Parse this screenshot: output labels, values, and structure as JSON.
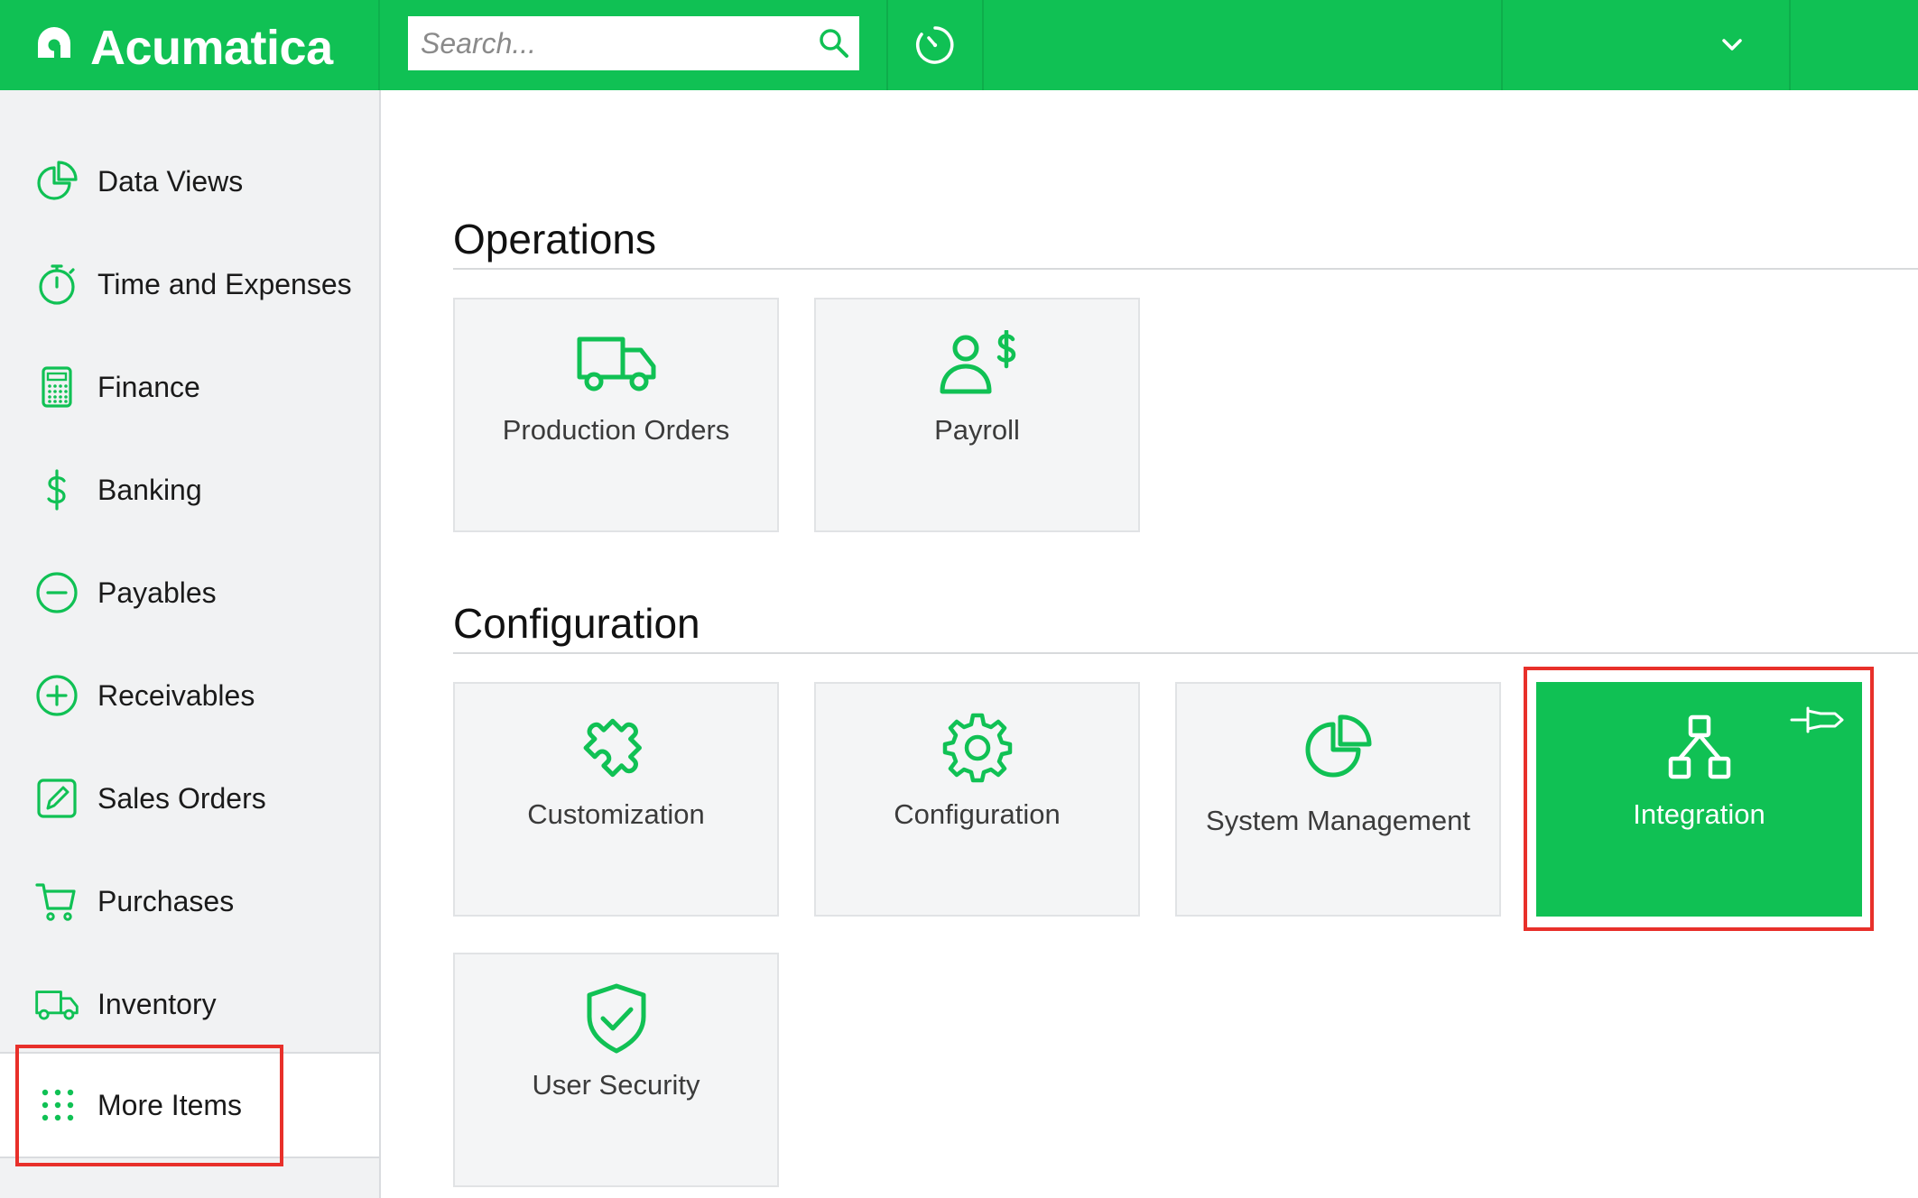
{
  "colors": {
    "brand_green": "#10c154",
    "highlight_red": "#e8302a"
  },
  "brand": {
    "name": "Acumatica",
    "icon": "acumatica-logo-icon"
  },
  "search": {
    "placeholder": "Search...",
    "value": "",
    "icon": "search-icon"
  },
  "toolbar": {
    "history_icon": "history-clock-icon",
    "dropdown_icon": "chevron-down-icon"
  },
  "sidebar": {
    "items": [
      {
        "label": "Data Views",
        "icon": "pie-chart-icon"
      },
      {
        "label": "Time and Expenses",
        "icon": "stopwatch-icon"
      },
      {
        "label": "Finance",
        "icon": "calculator-icon"
      },
      {
        "label": "Banking",
        "icon": "dollar-icon"
      },
      {
        "label": "Payables",
        "icon": "minus-circle-icon"
      },
      {
        "label": "Receivables",
        "icon": "plus-circle-icon"
      },
      {
        "label": "Sales Orders",
        "icon": "edit-icon"
      },
      {
        "label": "Purchases",
        "icon": "cart-icon"
      },
      {
        "label": "Inventory",
        "icon": "truck-icon"
      }
    ],
    "more_items": {
      "label": "More Items",
      "icon": "grid-dots-icon"
    }
  },
  "sections": [
    {
      "title": "Operations",
      "tiles": [
        {
          "label": "Production Orders",
          "icon": "truck-icon"
        },
        {
          "label": "Payroll",
          "icon": "person-dollar-icon"
        }
      ]
    },
    {
      "title": "Configuration",
      "tiles": [
        {
          "label": "Customization",
          "icon": "puzzle-icon"
        },
        {
          "label": "Configuration",
          "icon": "gear-icon"
        },
        {
          "label": "System Management",
          "icon": "pie-chart-icon"
        },
        {
          "label": "Integration",
          "icon": "hierarchy-icon",
          "active": true,
          "pin_icon": "pin-icon"
        },
        {
          "label": "User Security",
          "icon": "shield-check-icon"
        }
      ]
    }
  ]
}
